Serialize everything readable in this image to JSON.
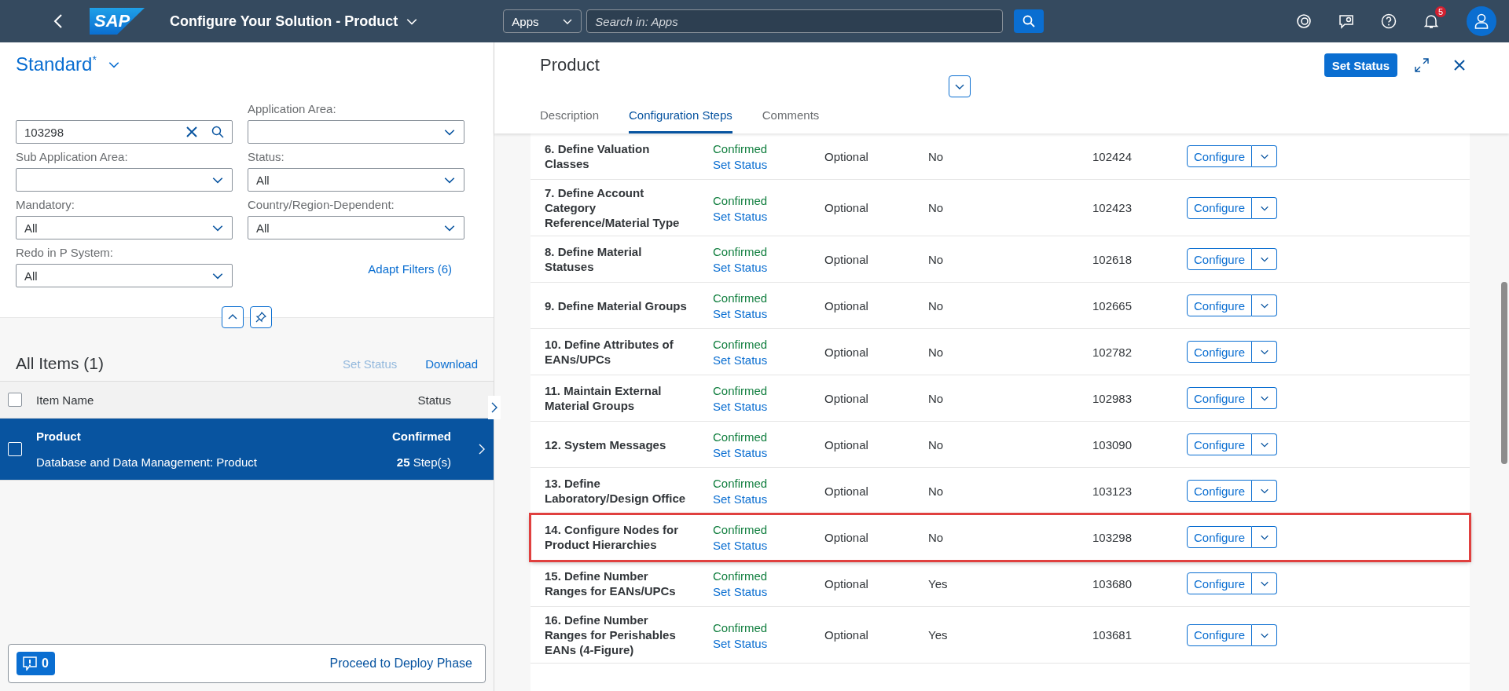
{
  "shell_bar": {
    "logo": "SAP",
    "title": "Configure Your Solution - Product",
    "scope": "Apps",
    "search": {
      "placeholder": "Search in: Apps"
    },
    "notification_count": "5"
  },
  "filter_bar": {
    "variant": "Standard$^{*}$",
    "search": {
      "value": "103298"
    },
    "filters": [
      {
        "label": "Application Area:"
      },
      {
        "label": "Sub Application Area:"
      },
      {
        "label": "Status:",
        "value": "All"
      },
      {
        "label": "Mandatory:",
        "value": "All"
      },
      {
        "label": "Country/Region-Dependent:",
        "value": "All"
      },
      {
        "label": "Redo in P System:",
        "value": "All"
      }
    ],
    "adapt_filters": "Adapt Filters (6)"
  },
  "list": {
    "title": "All Items (1)",
    "actions": [
      {
        "label": "Set Status",
        "disabled": true
      },
      {
        "label": "Download",
        "disabled": false
      }
    ],
    "select_all_checked": false,
    "columns": [
      "Item Name",
      "Status"
    ],
    "items": [
      {
        "name": "Product",
        "description": "Database and Data Management: Product",
        "status": "Confirmed",
        "steps": "**25** Step(s)",
        "checked": false,
        "selected": true
      }
    ]
  },
  "footer": {
    "message_count": "0",
    "action": "Proceed to Deploy Phase"
  },
  "detail": {
    "title": "Product",
    "action": "Set Status",
    "tabs": [
      {
        "label": "Description",
        "selected": false
      },
      {
        "label": "Configuration Steps",
        "selected": true
      },
      {
        "label": "Comments",
        "selected": false
      }
    ],
    "rows": [
      {
        "name": "6. Define Valuation Classes",
        "status": "Confirmed",
        "link": "Set Status",
        "type": "Optional",
        "country": "No",
        "id": "102424",
        "button": "Configure",
        "highlighted": false
      },
      {
        "name": "7. Define Account Category Reference/Material Type",
        "status": "Confirmed",
        "link": "Set Status",
        "type": "Optional",
        "country": "No",
        "id": "102423",
        "button": "Configure",
        "highlighted": false
      },
      {
        "name": "8. Define Material Statuses",
        "status": "Confirmed",
        "link": "Set Status",
        "type": "Optional",
        "country": "No",
        "id": "102618",
        "button": "Configure",
        "highlighted": false
      },
      {
        "name": "9. Define Material Groups",
        "status": "Confirmed",
        "link": "Set Status",
        "type": "Optional",
        "country": "No",
        "id": "102665",
        "button": "Configure",
        "highlighted": false
      },
      {
        "name": "10. Define Attributes of EANs/UPCs",
        "status": "Confirmed",
        "link": "Set Status",
        "type": "Optional",
        "country": "No",
        "id": "102782",
        "button": "Configure",
        "highlighted": false
      },
      {
        "name": "11. Maintain External Material Groups",
        "status": "Confirmed",
        "link": "Set Status",
        "type": "Optional",
        "country": "No",
        "id": "102983",
        "button": "Configure",
        "highlighted": false
      },
      {
        "name": "12. System Messages",
        "status": "Confirmed",
        "link": "Set Status",
        "type": "Optional",
        "country": "No",
        "id": "103090",
        "button": "Configure",
        "highlighted": false
      },
      {
        "name": "13. Define Laboratory/Design Office",
        "status": "Confirmed",
        "link": "Set Status",
        "type": "Optional",
        "country": "No",
        "id": "103123",
        "button": "Configure",
        "highlighted": false
      },
      {
        "name": "14. Configure Nodes for Product Hierarchies",
        "status": "Confirmed",
        "link": "Set Status",
        "type": "Optional",
        "country": "No",
        "id": "103298",
        "button": "Configure",
        "highlighted": true
      },
      {
        "name": "15. Define Number Ranges for EANs/UPCs",
        "status": "Confirmed",
        "link": "Set Status",
        "type": "Optional",
        "country": "Yes",
        "id": "103680",
        "button": "Configure",
        "highlighted": false
      },
      {
        "name": "16. Define Number Ranges for Perishables EANs (4-Figure)",
        "status": "Confirmed",
        "link": "Set Status",
        "type": "Optional",
        "country": "Yes",
        "id": "103681",
        "button": "Configure",
        "highlighted": false
      }
    ]
  }
}
